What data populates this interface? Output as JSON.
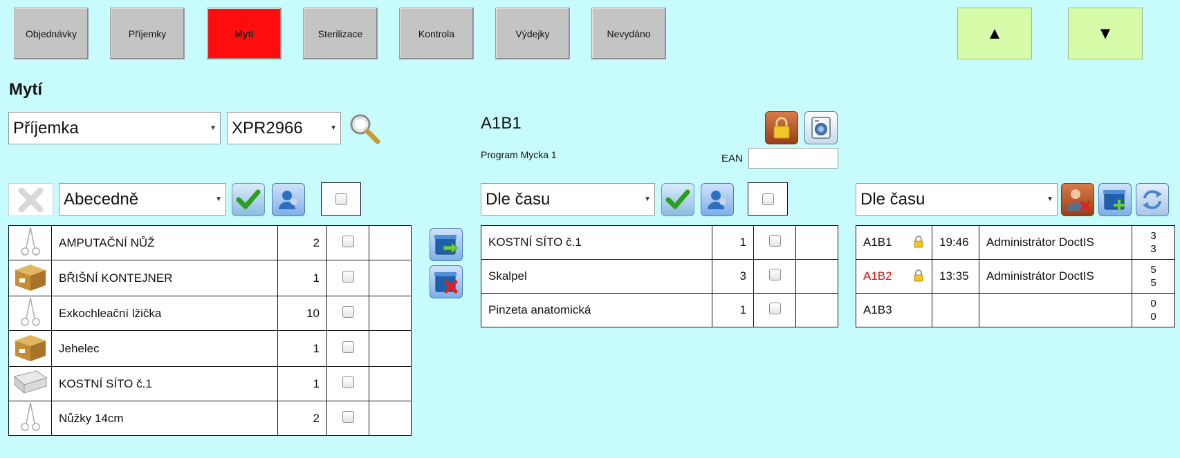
{
  "nav": {
    "items": [
      {
        "label": "Objednávky",
        "active": false
      },
      {
        "label": "Příjemky",
        "active": false
      },
      {
        "label": "Myti",
        "active": true
      },
      {
        "label": "Sterilizace",
        "active": false
      },
      {
        "label": "Kontrola",
        "active": false
      },
      {
        "label": "Výdejky",
        "active": false
      },
      {
        "label": "Nevydáno",
        "active": false
      }
    ],
    "up_label": "▲",
    "down_label": "▼"
  },
  "colors": {
    "background": "#c8fbfb",
    "active_tab": "#ff0d0d",
    "arrow_button": "#d6fcaa",
    "accent_red": "#e01010"
  },
  "page_title": "Mytí",
  "filter": {
    "doc_type": "Příjemka",
    "doc_number": "XPR2966"
  },
  "washer": {
    "name": "A1B1",
    "program": "Program Mycka 1",
    "ean_label": "EAN",
    "ean_value": ""
  },
  "left_panel": {
    "sort": "Abecedně",
    "rows": [
      {
        "name": "AMPUTAČNÍ NŮŽ",
        "qty": "2",
        "icon": "scissors-icon"
      },
      {
        "name": "BŘIŠNÍ KONTEJNER",
        "qty": "1",
        "icon": "box-icon"
      },
      {
        "name": "Exkochleační lžička",
        "qty": "10",
        "icon": "scissors-icon"
      },
      {
        "name": "Jehelec",
        "qty": "1",
        "icon": "box-icon"
      },
      {
        "name": "KOSTNÍ SÍTO č.1",
        "qty": "1",
        "icon": "tray-icon"
      },
      {
        "name": "Nůžky 14cm",
        "qty": "2",
        "icon": "scissors-icon"
      }
    ]
  },
  "middle_panel": {
    "sort": "Dle času",
    "rows": [
      {
        "name": "KOSTNÍ SÍTO č.1",
        "qty": "1"
      },
      {
        "name": "Skalpel",
        "qty": "3"
      },
      {
        "name": "Pinzeta anatomická",
        "qty": "1"
      }
    ]
  },
  "right_panel": {
    "sort": "Dle času",
    "rows": [
      {
        "code": "A1B1",
        "locked": true,
        "time": "19:46",
        "user": "Administrátor DoctIS",
        "count_a": "3",
        "count_b": "3"
      },
      {
        "code": "A1B2",
        "locked": true,
        "time": "13:35",
        "user": "Administrátor DoctIS",
        "count_a": "5",
        "count_b": "5"
      },
      {
        "code": "A1B3",
        "locked": false,
        "time": "",
        "user": "",
        "count_a": "0",
        "count_b": "0"
      }
    ]
  }
}
